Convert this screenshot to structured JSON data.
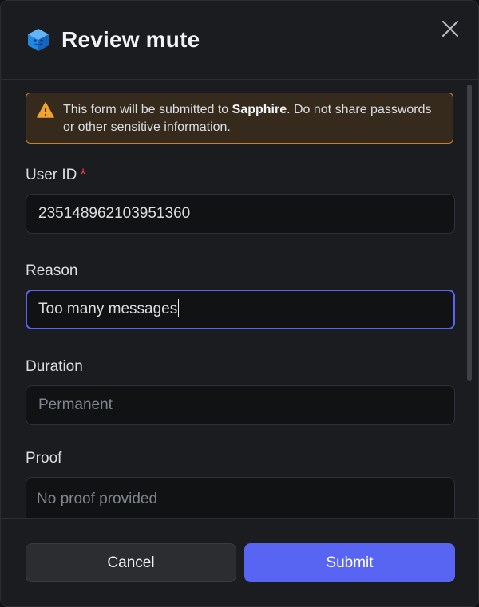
{
  "dialog": {
    "title": "Review mute",
    "app_icon": "sapphire-cube-icon",
    "close_icon": "close-icon"
  },
  "warning": {
    "text_before": "This form will be submitted to ",
    "app_name": "Sapphire",
    "text_after": ". Do not share passwords or other sensitive information.",
    "border_color": "#c7822f",
    "icon": "warning-triangle-icon"
  },
  "fields": {
    "user_id": {
      "label": "User ID",
      "required_marker": "*",
      "value": "235148962103951360"
    },
    "reason": {
      "label": "Reason",
      "value": "Too many messages"
    },
    "duration": {
      "label": "Duration",
      "placeholder": "Permanent"
    },
    "proof": {
      "label": "Proof",
      "placeholder": "No proof provided"
    }
  },
  "footer": {
    "cancel_label": "Cancel",
    "submit_label": "Submit"
  },
  "colors": {
    "accent": "#5865f2",
    "warning": "#c7822f",
    "required": "#f23f43",
    "background": "#1b1c1f"
  }
}
